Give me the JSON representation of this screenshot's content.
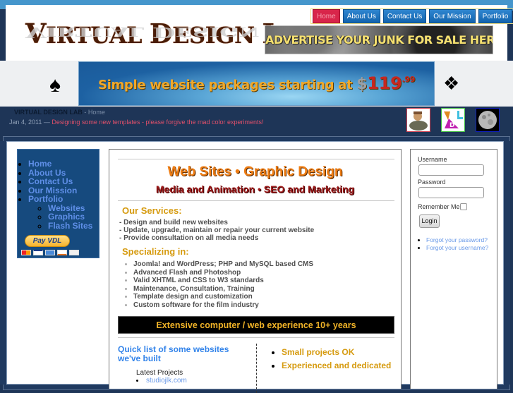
{
  "header": {
    "logo_text": "Virtual Design Lab",
    "nav": [
      {
        "label": "Home",
        "active": true
      },
      {
        "label": "About Us"
      },
      {
        "label": "Contact Us"
      },
      {
        "label": "Our Mission"
      },
      {
        "label": "Portfolio"
      }
    ],
    "ad_banner": "ADVERTISE YOUR JUNK FOR SALE HERE!"
  },
  "promo": {
    "text": "Simple website packages starting at",
    "dollar": "$",
    "price": "119",
    "cents": ".99",
    "left_icon": "spade-icon",
    "right_icon": "diamonds-icon"
  },
  "info_bar": {
    "site_name": "VIRTUAL DESIGN LAB",
    "separator": " - ",
    "page": "Home",
    "date": "Jan 4, 2011 — ",
    "headline": "Designing some new templates - please forgive the mad color experiments!"
  },
  "left_menu": {
    "items": [
      "Home",
      "About Us",
      "Contact Us",
      "Our Mission",
      "Portfolio"
    ],
    "sub_items": [
      "Websites",
      "Graphics",
      "Flash Sites"
    ],
    "paypal_label": "Pay VDL"
  },
  "main": {
    "headline1": "Web Sites • Graphic Design",
    "headline2": "Media and Animation • SEO and Marketing",
    "services_heading": "Our Services:",
    "services": [
      "- Design and build new websites",
      "- Update, upgrade, maintain or repair your current website",
      "- Provide consultation on all media needs"
    ],
    "specializing_heading": "Specializing in:",
    "specializing": [
      "Joomla! and WordPress; PHP and MySQL based CMS",
      "Advanced Flash and Photoshop",
      "Valid XHTML and CSS to W3 standards",
      "Maintenance, Consultation, Training",
      "Template design and customization",
      "Custom software for the film industry"
    ],
    "experience_bar": "Extensive computer / web experience 10+ years",
    "quick_list_heading": "Quick list of some websites we've built",
    "latest_projects_label": "Latest Projects",
    "projects": [
      "studiojlk.com"
    ],
    "right_points": [
      "Small projects OK",
      "Experienced and dedicated"
    ]
  },
  "login": {
    "username_label": "Username",
    "username_value": "",
    "password_label": "Password",
    "password_value": "",
    "remember_label": "Remember Me",
    "remember_checked": false,
    "login_button": "Login",
    "forgot_password": "Forgot your password?",
    "forgot_username": "Forgot your username?"
  }
}
